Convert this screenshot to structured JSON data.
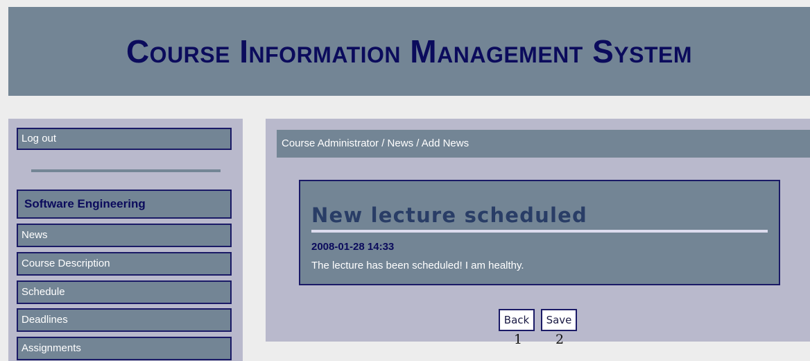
{
  "header": {
    "title": "Course Information Management System"
  },
  "sidebar": {
    "logout_label": "Log out",
    "course_title": "Software Engineering",
    "items": [
      {
        "label": "News"
      },
      {
        "label": "Course Description"
      },
      {
        "label": "Schedule"
      },
      {
        "label": "Deadlines"
      },
      {
        "label": "Assignments"
      }
    ]
  },
  "main": {
    "breadcrumb": "Course Administrator / News / Add News",
    "news": {
      "title": "New lecture scheduled",
      "date": "2008-01-28 14:33",
      "body": "The lecture has been scheduled! I am healthy."
    },
    "buttons": {
      "back_label": "Back",
      "save_label": "Save"
    }
  },
  "annotations": {
    "back_number": "1",
    "save_number": "2"
  },
  "colors": {
    "header_bg": "#738595",
    "title_color": "#0b0b5c",
    "panel_bg": "#b9b9cc",
    "box_border": "#1a1a66"
  }
}
